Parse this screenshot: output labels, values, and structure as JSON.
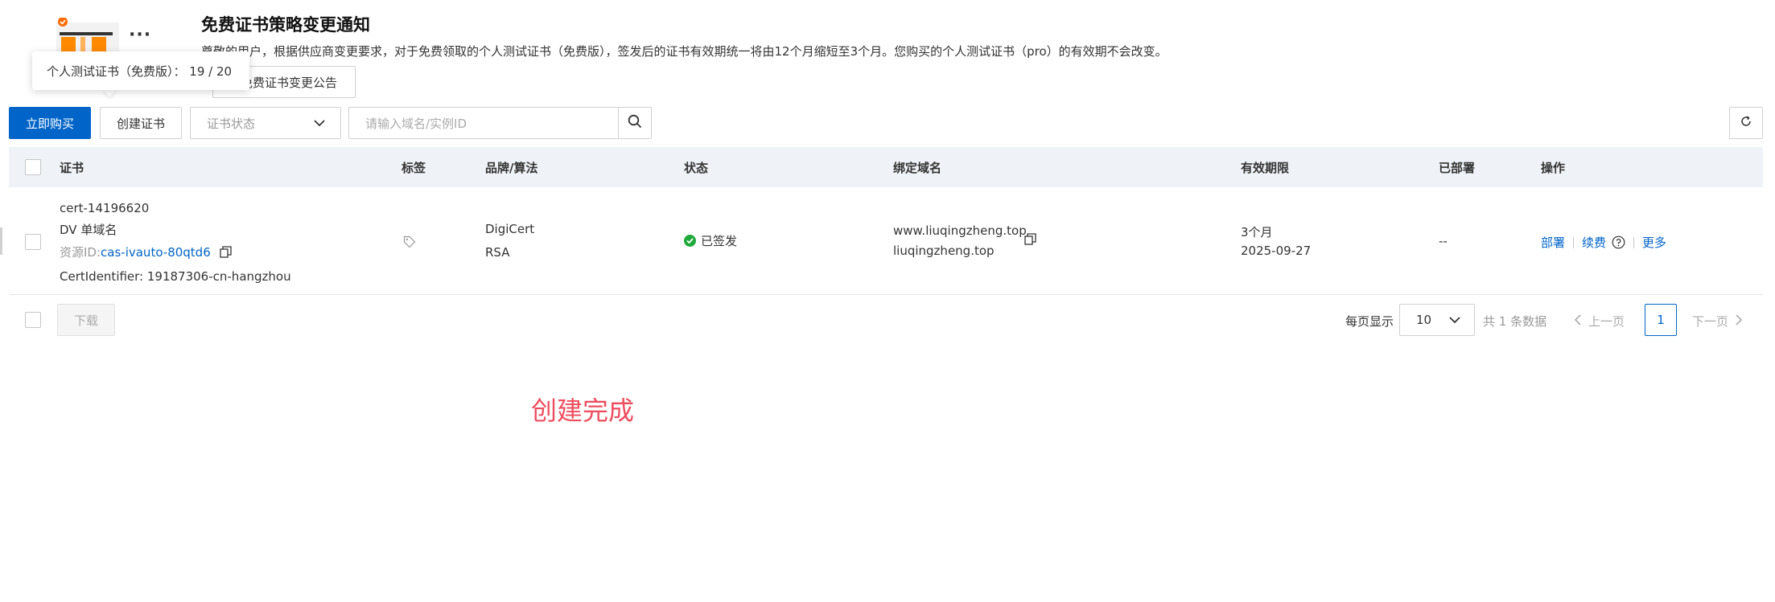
{
  "notice": {
    "title": "免费证书策略变更通知",
    "text": "尊敬的用户，根据供应商变更要求，对于免费领取的个人测试证书（免费版），签发后的证书有效期统一将由12个月缩短至3个月。您购买的个人测试证书（pro）的有效期不会改变。",
    "announce_button": "免费证书变更公告",
    "more": "···"
  },
  "tooltip": {
    "text": "个人测试证书（免费版）：  19 / 20"
  },
  "toolbar": {
    "buy_button": "立即购买",
    "create_button": "创建证书",
    "status_placeholder": "证书状态",
    "search_placeholder": "请输入域名/实例ID"
  },
  "table": {
    "headers": {
      "cert": "证书",
      "tag": "标签",
      "brand": "品牌/算法",
      "status": "状态",
      "domain": "绑定域名",
      "validity": "有效期限",
      "deployed": "已部署",
      "actions": "操作"
    },
    "rows": [
      {
        "name": "cert-14196620",
        "type": "DV 单域名",
        "resource_label": "资源ID:",
        "resource_id": "cas-ivauto-80qtd6",
        "identifier": "CertIdentifier: 19187306-cn-hangzhou",
        "brand": "DigiCert",
        "algorithm": "RSA",
        "status": "已签发",
        "domain1": "www.liuqingzheng.top",
        "domain2": "liuqingzheng.top",
        "validity": "3个月",
        "expire": "2025-09-27",
        "deployed": "--",
        "action_deploy": "部署",
        "action_renew": "续费",
        "action_more": "更多"
      }
    ]
  },
  "footer": {
    "download_button": "下载",
    "per_page_label": "每页显示",
    "per_page_value": "10",
    "total": "共 1 条数据",
    "prev": "上一页",
    "current_page": "1",
    "next": "下一页"
  },
  "overlay_text": "创建完成",
  "colors": {
    "primary": "#0064c8",
    "success": "#1ea93a",
    "annotation": "#ee4d5e",
    "header_bg": "#eff2f6"
  }
}
